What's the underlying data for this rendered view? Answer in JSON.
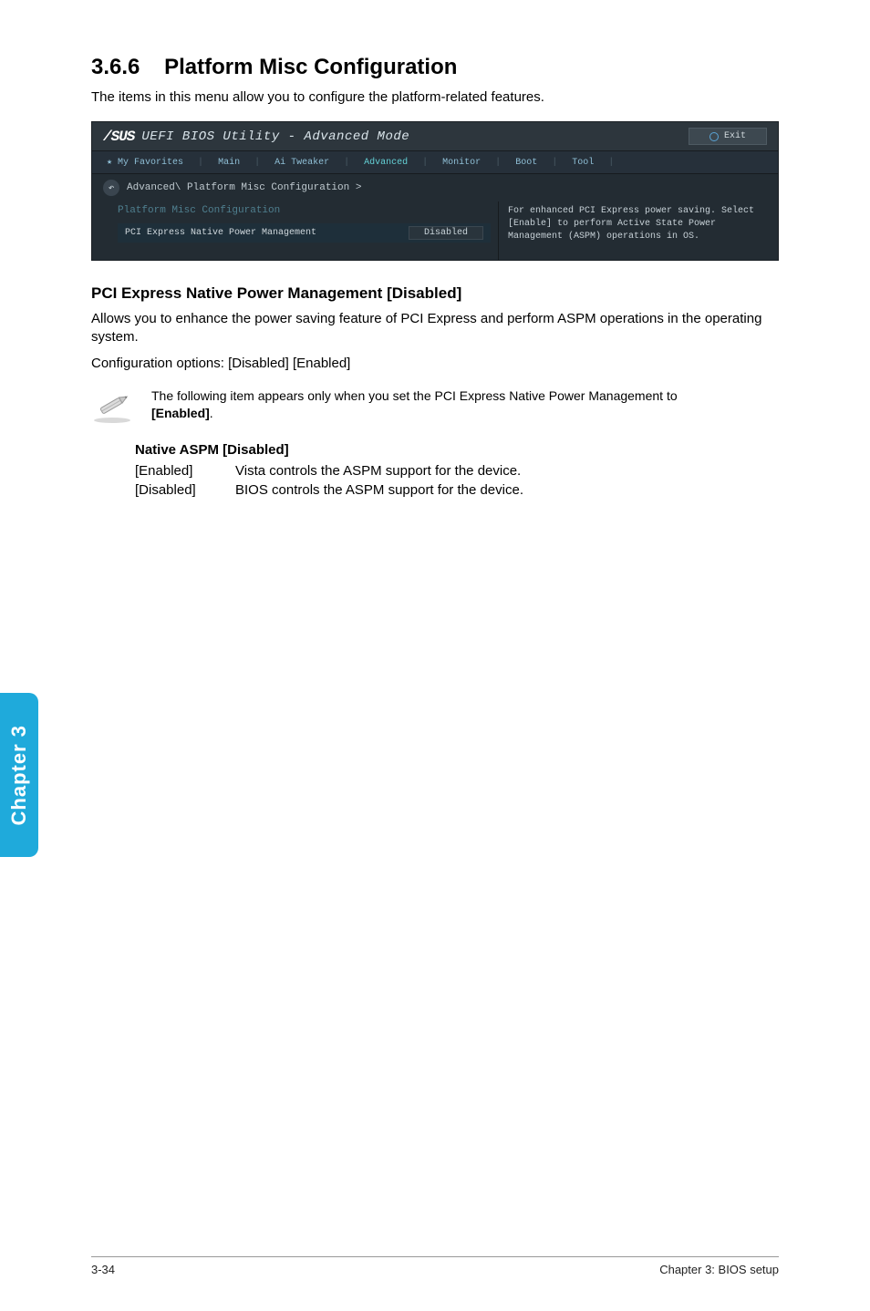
{
  "heading_number": "3.6.6",
  "heading_title": "Platform Misc Configuration",
  "intro": "The items in this menu allow you to configure the platform-related features.",
  "bios": {
    "logo": "/SUS",
    "titlebar": "UEFI BIOS Utility - Advanced Mode",
    "exit": "Exit",
    "menu": {
      "star": "★ My Favorites",
      "main": "Main",
      "tweaker": "Ai Tweaker",
      "advanced": "Advanced",
      "monitor": "Monitor",
      "boot": "Boot",
      "tool": "Tool"
    },
    "crumb": "Advanced\\ Platform Misc Configuration >",
    "panel_title": "Platform Misc Configuration",
    "row_label": "PCI Express Native Power Management",
    "row_value": "Disabled",
    "help": "For enhanced PCI Express power saving. Select [Enable] to perform Active State Power Management (ASPM) operations in OS."
  },
  "sub_heading": "PCI Express Native Power Management [Disabled]",
  "sub_desc": "Allows you to enhance the power saving feature of PCI Express and perform ASPM operations in the operating system.",
  "config_line": "Configuration options: [Disabled] [Enabled]",
  "note_prefix": "The following item appears only when you set the PCI Express Native Power Management to ",
  "note_bold": "[Enabled]",
  "note_suffix": ".",
  "native_heading": "Native ASPM [Disabled]",
  "defs": {
    "enabled_key": "[Enabled]",
    "enabled_val": "Vista controls the ASPM support for the device.",
    "disabled_key": "[Disabled]",
    "disabled_val": "BIOS controls the ASPM support for the device."
  },
  "side_tab": "Chapter 3",
  "footer_left": "3-34",
  "footer_right": "Chapter 3: BIOS setup"
}
